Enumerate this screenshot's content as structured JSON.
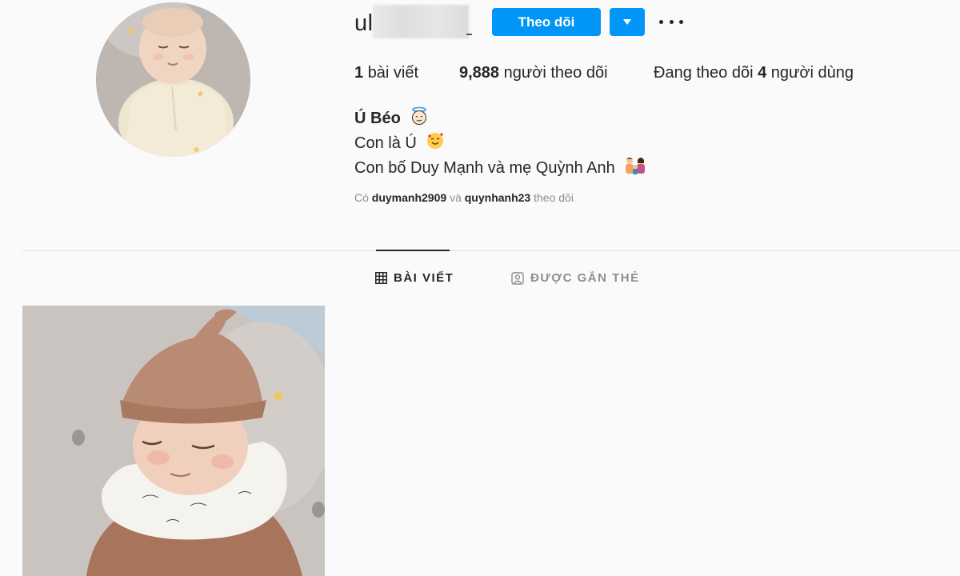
{
  "profile": {
    "username_visible": "ul",
    "follow_label": "Theo dõi",
    "stats": {
      "posts_count": "1",
      "posts_label": "bài viết",
      "followers_count": "9,888",
      "followers_label": "người theo dõi",
      "following_prefix": "Đang theo dõi",
      "following_count": "4",
      "following_suffix": "người dùng"
    },
    "bio": {
      "name": "Ú Béo",
      "line1": "Con là Ú",
      "line2": "Con bố Duy Mạnh và mẹ Quỳnh Anh"
    },
    "followed_by": {
      "prefix": "Có",
      "user1": "duymanh2909",
      "conjunction": "và",
      "user2": "quynhanh23",
      "suffix": "theo dõi"
    }
  },
  "tabs": [
    {
      "label": "BÀI VIẾT",
      "icon": "grid-icon",
      "active": true
    },
    {
      "label": "ĐƯỢC GẮN THẺ",
      "icon": "tagged-user-icon",
      "active": false
    }
  ],
  "colors": {
    "accent": "#0095f6",
    "background": "#fafafa",
    "text": "#262626",
    "muted": "#8e8e8e"
  }
}
